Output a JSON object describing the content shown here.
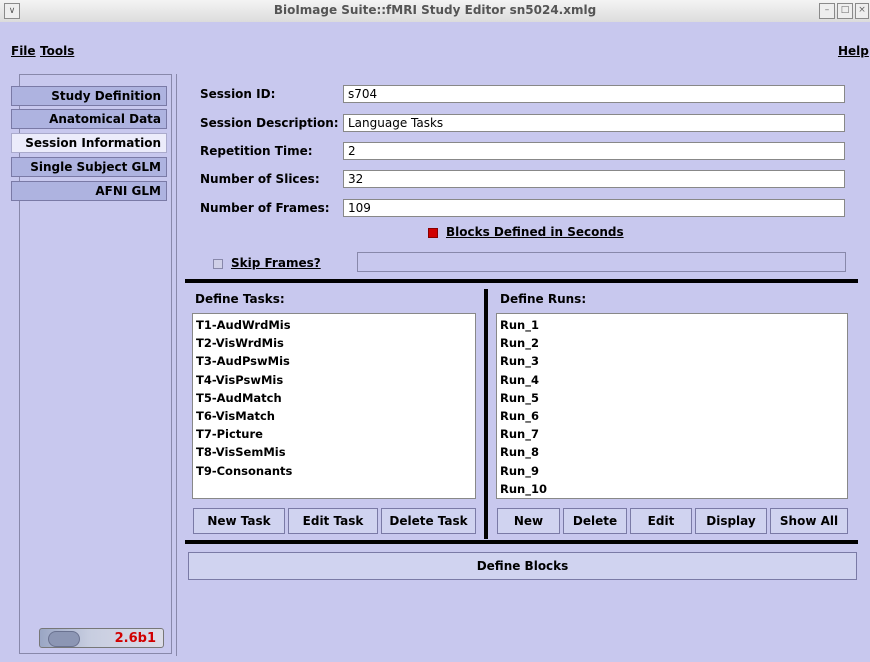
{
  "window": {
    "title": "BioImage Suite::fMRI Study Editor sn5024.xmlg"
  },
  "menu": {
    "file": "File",
    "tools": "Tools",
    "help": "Help"
  },
  "sidebar": {
    "items": [
      {
        "label": "Study Definition"
      },
      {
        "label": "Anatomical Data"
      },
      {
        "label": "Session Information"
      },
      {
        "label": "Single Subject GLM"
      },
      {
        "label": "AFNI GLM"
      }
    ],
    "selected": "Session Information",
    "version": "2.6b1"
  },
  "session": {
    "fields": [
      {
        "label": "Session ID:",
        "value": "s704"
      },
      {
        "label": "Session Description:",
        "value": "Language Tasks"
      },
      {
        "label": "Repetition Time:",
        "value": "2"
      },
      {
        "label": "Number of Slices:",
        "value": "32"
      },
      {
        "label": "Number of Frames:",
        "value": "109"
      }
    ],
    "blocks_seconds_label": "Blocks Defined in Seconds",
    "blocks_seconds_checked": true,
    "skip_frames_label": "Skip Frames?",
    "skip_frames_checked": false,
    "skip_frames_value": ""
  },
  "tasks": {
    "header": "Define Tasks:",
    "items": [
      "T1-AudWrdMis",
      "T2-VisWrdMis",
      "T3-AudPswMis",
      "T4-VisPswMis",
      "T5-AudMatch",
      "T6-VisMatch",
      "T7-Picture",
      "T8-VisSemMis",
      "T9-Consonants"
    ],
    "buttons": {
      "new": "New Task",
      "edit": "Edit Task",
      "delete": "Delete Task"
    }
  },
  "runs": {
    "header": "Define Runs:",
    "items": [
      "Run_1",
      "Run_2",
      "Run_3",
      "Run_4",
      "Run_5",
      "Run_6",
      "Run_7",
      "Run_8",
      "Run_9",
      "Run_10"
    ],
    "buttons": {
      "new": "New",
      "delete": "Delete",
      "edit": "Edit",
      "display": "Display",
      "show_all": "Show All"
    }
  },
  "define_blocks_label": "Define Blocks",
  "colors": {
    "panel_bg": "#c8c8ee",
    "radio_on": "#d00000",
    "version_text": "#d10000"
  }
}
